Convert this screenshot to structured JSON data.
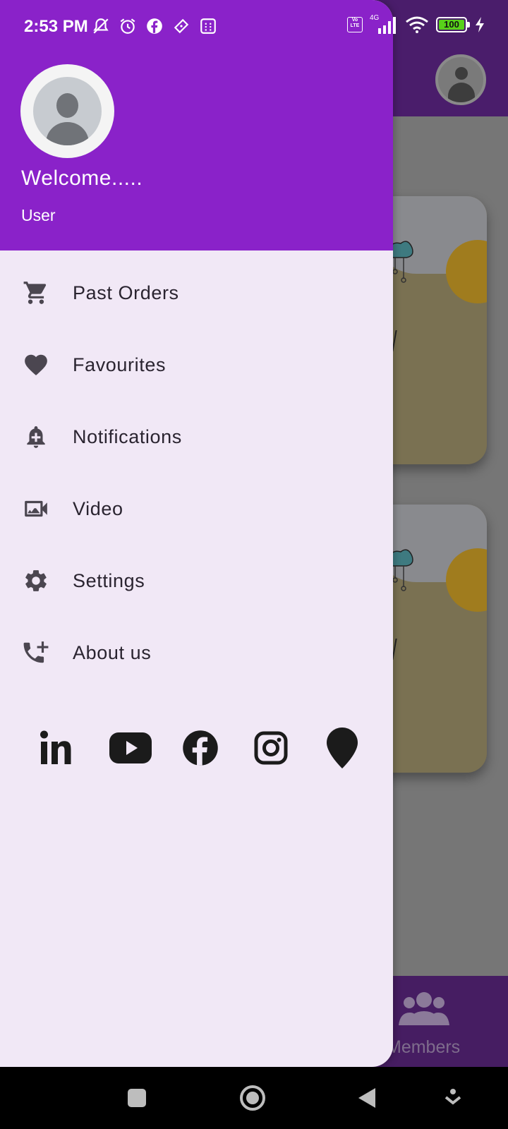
{
  "status_bar": {
    "time": "2:53 PM",
    "network": "4G",
    "volte": "Vo LTE",
    "battery": "100"
  },
  "drawer": {
    "welcome": "Welcome.....",
    "user": "User",
    "menu": [
      {
        "label": "Past Orders",
        "icon": "cart-icon"
      },
      {
        "label": "Favourites",
        "icon": "heart-icon"
      },
      {
        "label": "Notifications",
        "icon": "bell-plus-icon"
      },
      {
        "label": "Video",
        "icon": "video-icon"
      },
      {
        "label": "Settings",
        "icon": "gear-icon"
      },
      {
        "label": "About us",
        "icon": "phone-plus-icon"
      }
    ],
    "socials": [
      "linkedin-icon",
      "youtube-icon",
      "facebook-icon",
      "instagram-icon",
      "location-pin-icon"
    ]
  },
  "background": {
    "bottom_nav_label": "Members"
  },
  "colors": {
    "drawer_header": "#8a22c9",
    "drawer_body": "#f1e8f6",
    "app_bar_dimmed": "#4a1d6b"
  }
}
